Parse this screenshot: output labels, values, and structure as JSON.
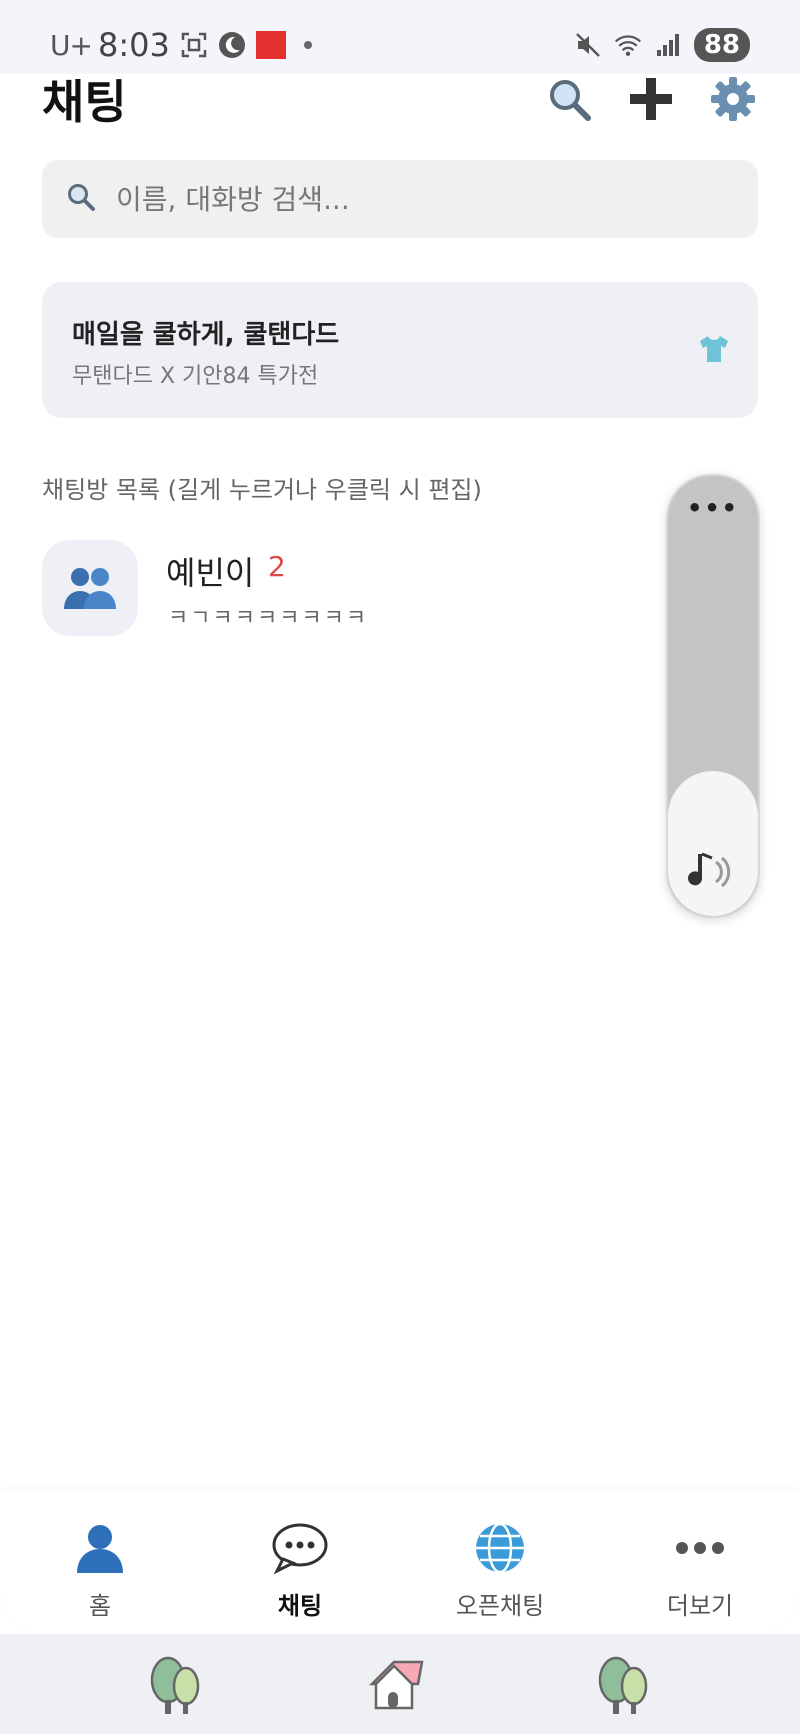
{
  "status_bar": {
    "carrier": "U+",
    "time": "8:03",
    "battery": "88"
  },
  "header": {
    "title": "채팅"
  },
  "search": {
    "placeholder": "이름, 대화방 검색..."
  },
  "banner": {
    "title": "매일을 쿨하게, 쿨탠다드",
    "subtitle": "무탠다드 X 기안84 특가전"
  },
  "section_label": "채팅방 목록 (길게 누르거나 우클릭 시 편집)",
  "chats": [
    {
      "name": "예빈이",
      "count": "2",
      "preview": "ㅋㄱㅋㅋㅋㅋㅋㅋㅋ"
    }
  ],
  "volume_panel": {
    "more": "•••",
    "level": 0.33
  },
  "bottom_nav": [
    {
      "label": "홈",
      "icon": "person-icon"
    },
    {
      "label": "채팅",
      "icon": "speech-bubble-icon",
      "active": true
    },
    {
      "label": "오픈채팅",
      "icon": "globe-icon"
    },
    {
      "label": "더보기",
      "icon": "more-dots-icon"
    }
  ],
  "colors": {
    "accent_red": "#e04848",
    "status_bg": "#f4f5fa",
    "banner_bg": "#eef0f6"
  }
}
